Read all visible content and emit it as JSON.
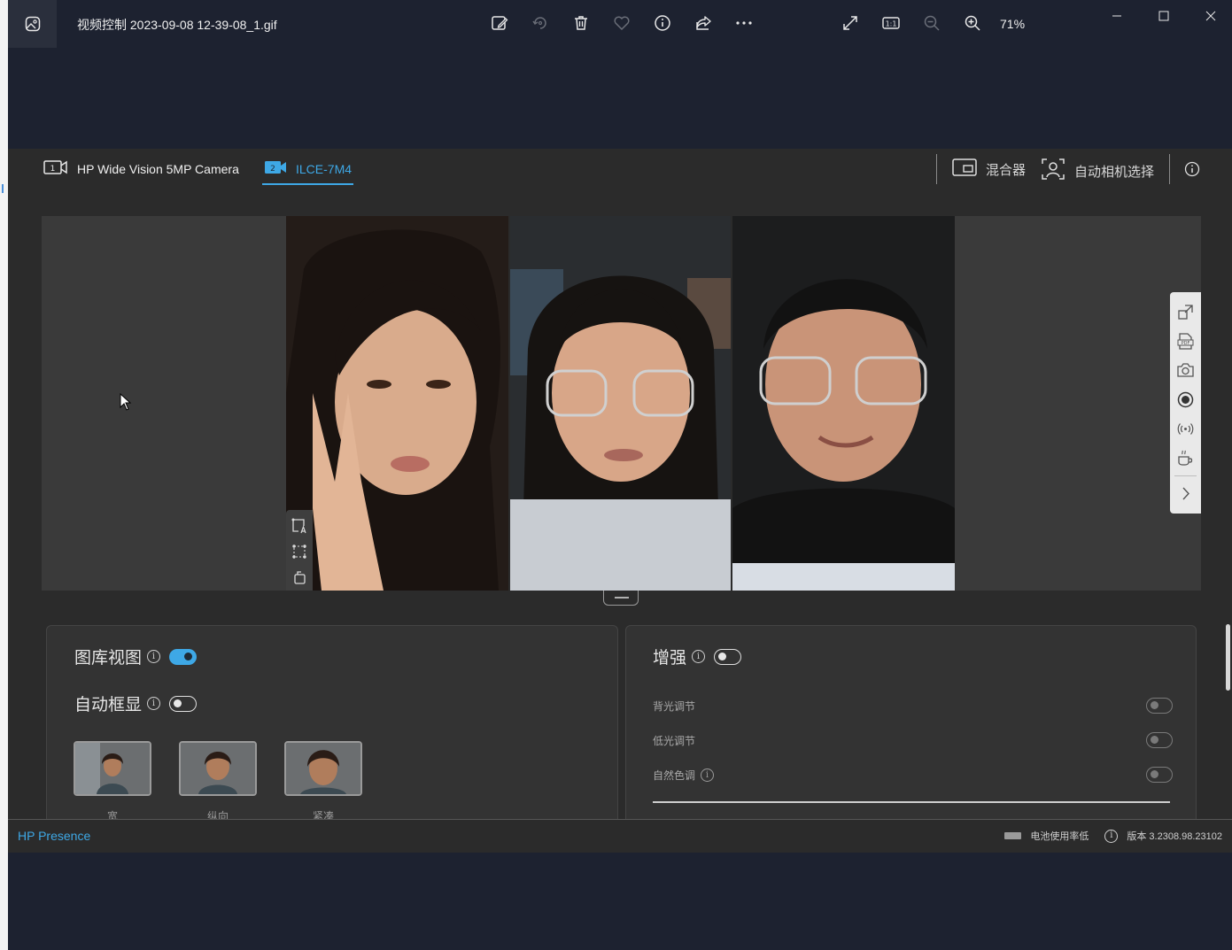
{
  "viewer": {
    "filename": "视频控制 2023-09-08 12-39-08_1.gif",
    "zoom": "71%",
    "toolbar_icons": [
      "edit-image-icon",
      "rotate-icon",
      "delete-icon",
      "favorite-icon",
      "info-icon",
      "share-icon",
      "more-icon"
    ],
    "zoom_icons": [
      "fullscreen-icon",
      "actual-size-icon",
      "zoom-out-icon",
      "zoom-in-icon"
    ]
  },
  "app": {
    "cameras": [
      {
        "badge": "1",
        "label": "HP Wide Vision 5MP Camera",
        "active": false
      },
      {
        "badge": "2",
        "label": "ILCE-7M4",
        "active": true
      }
    ],
    "mixer_label": "混合器",
    "auto_camera_label": "自动相机选择"
  },
  "gallery_card": {
    "gallery_view_label": "图库视图",
    "gallery_view_on": true,
    "auto_frame_label": "自动框显",
    "auto_frame_on": false,
    "framing_options": [
      "宽",
      "纵向",
      "紧凑"
    ]
  },
  "enhance_card": {
    "label": "增强",
    "on": false,
    "options": [
      {
        "label": "背光调节",
        "on": false,
        "info": false
      },
      {
        "label": "低光调节",
        "on": false,
        "info": false
      },
      {
        "label": "自然色调",
        "on": false,
        "info": true
      }
    ]
  },
  "status": {
    "brand": "HP Presence",
    "battery_label": "电池使用率低",
    "version": "版本 3.2308.98.23102"
  },
  "colors": {
    "accent": "#3ea8e6",
    "viewer_bg": "#1d2230",
    "app_bg": "#2b2b2b"
  }
}
